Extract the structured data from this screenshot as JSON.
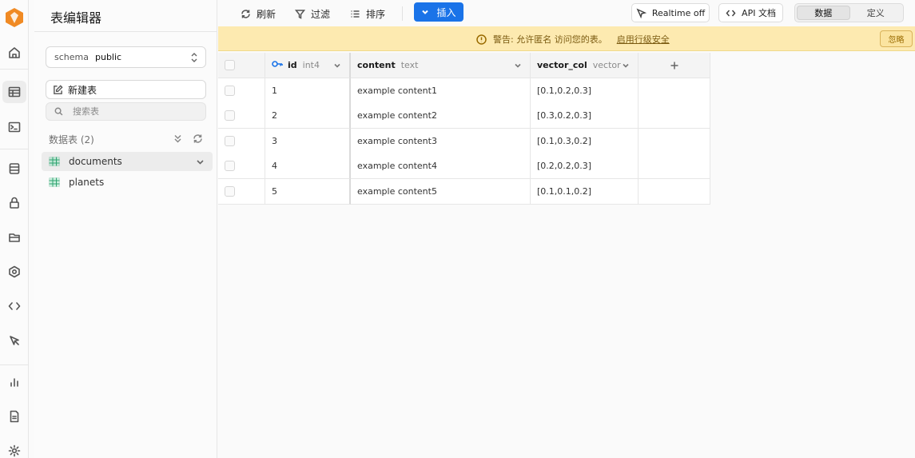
{
  "sidebar_rail": {
    "icons": [
      "logo-icon",
      "home-icon",
      "table-editor-icon",
      "sql-editor-icon",
      "database-icon",
      "auth-icon",
      "storage-icon",
      "edge-functions-icon",
      "api-icon",
      "realtime-icon",
      "reports-icon",
      "logs-icon",
      "settings-icon"
    ]
  },
  "panel": {
    "title": "表编辑器",
    "schema_label": "schema",
    "schema_value": "public",
    "new_table_label": "新建表",
    "search_placeholder": "搜索表",
    "tables_heading": "数据表 (2)",
    "tables": [
      {
        "name": "documents",
        "selected": true
      },
      {
        "name": "planets",
        "selected": false
      }
    ]
  },
  "toolbar": {
    "refresh_label": "刷新",
    "filter_label": "过滤",
    "sort_label": "排序",
    "insert_label": "插入",
    "realtime_label": "Realtime off",
    "api_docs_label": "API 文档",
    "view_data_label": "数据",
    "view_definition_label": "定义",
    "active_view": "数据"
  },
  "banner": {
    "message": "警告: 允许匿名 访问您的表。",
    "link_label": "启用行级安全",
    "ignore_label": "忽略"
  },
  "grid": {
    "columns": [
      {
        "name": "id",
        "type": "int4",
        "primary_key": true
      },
      {
        "name": "content",
        "type": "text"
      },
      {
        "name": "vector_col",
        "type": "vector"
      }
    ],
    "rows": [
      {
        "id": "1",
        "content": "example content1",
        "vector_col": "[0.1,0.2,0.3]"
      },
      {
        "id": "2",
        "content": "example content2",
        "vector_col": "[0.3,0.2,0.3]"
      },
      {
        "id": "3",
        "content": "example content3",
        "vector_col": "[0.1,0.3,0.2]"
      },
      {
        "id": "4",
        "content": "example content4",
        "vector_col": "[0.2,0.2,0.3]"
      },
      {
        "id": "5",
        "content": "example content5",
        "vector_col": "[0.1,0.1,0.2]"
      }
    ]
  },
  "colors": {
    "accent": "#1a73e8",
    "banner_bg": "#fdeab0",
    "logo": "#f08a24"
  }
}
